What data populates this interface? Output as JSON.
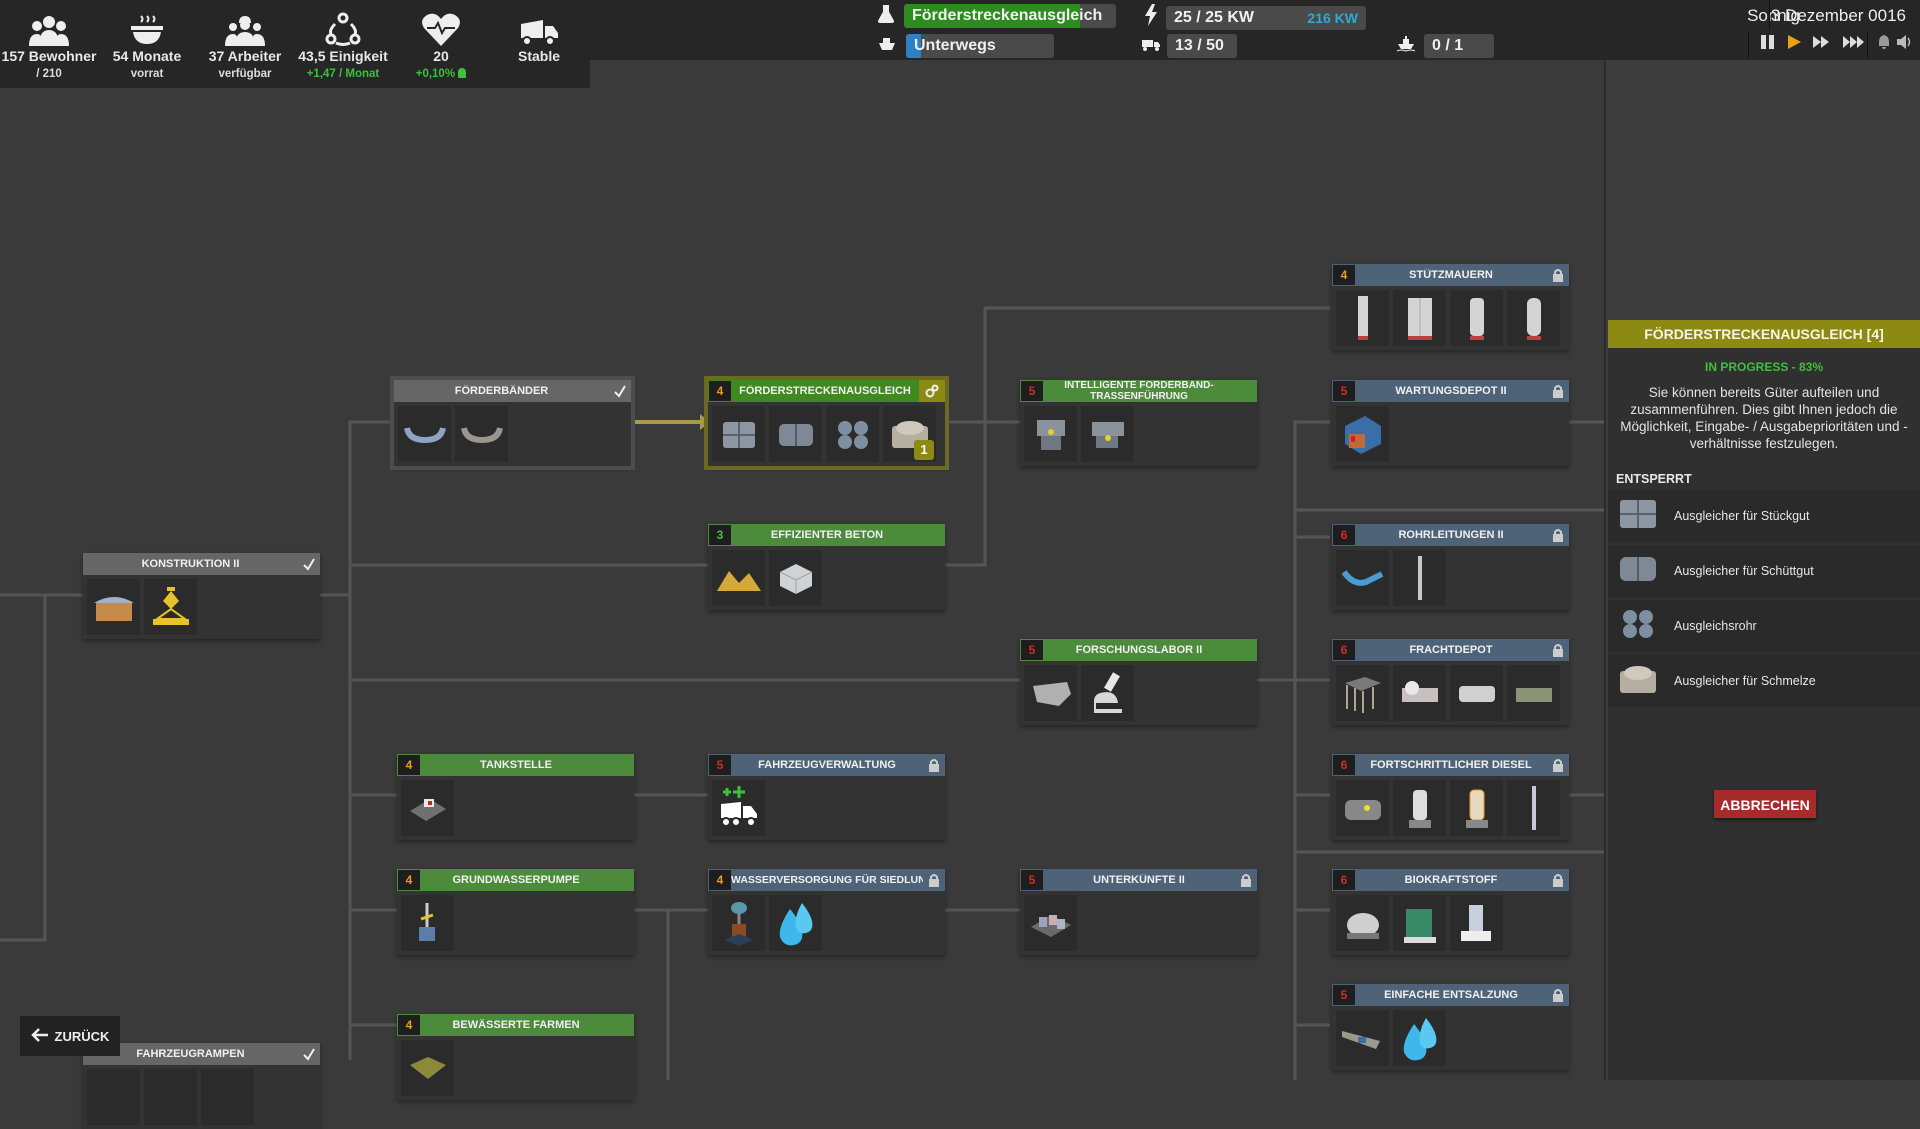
{
  "stats": [
    {
      "icon": "population-icon",
      "main": "157 Bewohner",
      "sub": "/ 210",
      "sub_green": false
    },
    {
      "icon": "food-bowl-icon",
      "main": "54 Monate",
      "sub": "vorrat",
      "sub_green": false
    },
    {
      "icon": "workers-icon",
      "main": "37 Arbeiter",
      "sub": "verfügbar",
      "sub_green": false
    },
    {
      "icon": "unity-icon",
      "main": "43,5 Einigkeit",
      "sub": "+1,47 / Monat",
      "sub_green": true
    },
    {
      "icon": "health-icon",
      "main": "20",
      "sub": "+0,10%",
      "sub_green": true
    },
    {
      "icon": "truck-icon",
      "main": "Stable",
      "sub": "",
      "sub_green": false
    }
  ],
  "topbar": {
    "research": {
      "label": "Förderstreckenausgleich",
      "progress": 0.83,
      "color": "#2e8b1f"
    },
    "status": {
      "label": "Unterwegs",
      "progress": 0.1,
      "color": "#2f7fc4"
    },
    "power": {
      "label": "25 / 25 KW",
      "extra": "216 KW"
    },
    "vehicles": {
      "label": "13 / 50"
    },
    "ships": {
      "label": "0 / 1"
    },
    "weather": "Sonnig",
    "date": "3 Dezember 0016"
  },
  "sidebar": {
    "title": "FÖRDERSTRECKENAUSGLEICH [4]",
    "status": "IN PROGRESS - 83%",
    "description": "Sie können bereits Güter aufteilen und zusammenführen. Dies gibt Ihnen jedoch die Möglichkeit, Eingabe- / Ausgabeprioritäten und -verhältnisse festzulegen.",
    "unlocked_label": "ENTSPERRT",
    "unlocked": [
      {
        "label": "Ausgleicher für Stückgut",
        "icon": "unit-balancer-icon"
      },
      {
        "label": "Ausgleicher für Schüttgut",
        "icon": "loose-balancer-icon"
      },
      {
        "label": "Ausgleichsrohr",
        "icon": "pipe-balancer-icon"
      },
      {
        "label": "Ausgleicher für Schmelze",
        "icon": "molten-balancer-icon"
      }
    ],
    "cancel_label": "ABBRECHEN"
  },
  "back_label": "ZURÜCK",
  "nodes": {
    "foerderbaender": {
      "title": "FÖRDERBÄNDER",
      "level": "",
      "state": "done"
    },
    "ausgleich": {
      "title": "FÖRDERSTRECKENAUSGLEICH",
      "level": "4",
      "state": "active",
      "badge": "1"
    },
    "beton": {
      "title": "EFFIZIENTER BETON",
      "level": "3",
      "state": "available"
    },
    "konstruktion": {
      "title": "KONSTRUKTION II",
      "level": "",
      "state": "done"
    },
    "intelligente": {
      "title": "INTELLIGENTE FÖRDERBAND-TRASSENFÜHRUNG",
      "level": "5",
      "state": "available"
    },
    "forschungslabor": {
      "title": "FORSCHUNGSLABOR II",
      "level": "5",
      "state": "available"
    },
    "tankstelle": {
      "title": "TANKSTELLE",
      "level": "4",
      "state": "available"
    },
    "fahrzeugverwaltung": {
      "title": "FAHRZEUGVERWALTUNG",
      "level": "5",
      "state": "locked"
    },
    "grundwasser": {
      "title": "GRUNDWASSERPUMPE",
      "level": "4",
      "state": "available"
    },
    "wasserversorgung": {
      "title": "WASSERVERSORGUNG FÜR SIEDLUNGEN",
      "level": "4",
      "state": "locked"
    },
    "unterkuenfte": {
      "title": "UNTERKÜNFTE II",
      "level": "5",
      "state": "locked"
    },
    "farmen": {
      "title": "BEWÄSSERTE FARMEN",
      "level": "4",
      "state": "available"
    },
    "rampen": {
      "title": "FAHRZEUGRAMPEN",
      "level": "",
      "state": "done"
    },
    "stuetzmauern": {
      "title": "STÜTZMAUERN",
      "level": "4",
      "state": "locked"
    },
    "wartungsdepot": {
      "title": "WARTUNGSDEPOT II",
      "level": "5",
      "state": "locked"
    },
    "rohrleitungen": {
      "title": "ROHRLEITUNGEN II",
      "level": "6",
      "state": "locked"
    },
    "frachtdepot": {
      "title": "FRACHTDEPOT",
      "level": "6",
      "state": "locked"
    },
    "diesel": {
      "title": "FORTSCHRITTLICHER DIESEL",
      "level": "6",
      "state": "locked"
    },
    "biokraftstoff": {
      "title": "BIOKRAFTSTOFF",
      "level": "6",
      "state": "locked"
    },
    "entsalzung": {
      "title": "EINFACHE ENTSALZUNG",
      "level": "5",
      "state": "locked"
    }
  }
}
